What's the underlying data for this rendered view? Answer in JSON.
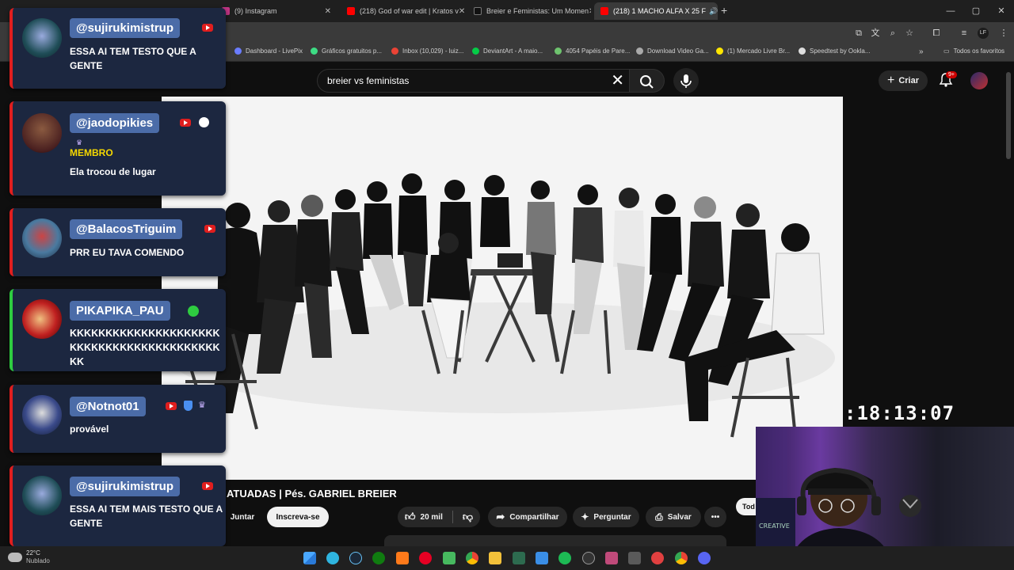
{
  "browser": {
    "tabs": [
      {
        "label": "(9) Instagram",
        "favicon_color": "#c13584",
        "active": false
      },
      {
        "label": "(218) God of war edit | Kratos v",
        "favicon_color": "#ff0000",
        "active": false
      },
      {
        "label": "Breier e Feministas: Um Momen",
        "favicon_color": "#111111",
        "active": false
      },
      {
        "label": "(218) 1 MACHO ALFA X 25 F",
        "favicon_color": "#ff0000",
        "active": true
      }
    ],
    "bookmarks": [
      {
        "label": "Dashboard - LivePix",
        "color": "#6a7cff"
      },
      {
        "label": "Gráficos gratuitos p...",
        "color": "#3ddc84"
      },
      {
        "label": "Inbox (10,029) - luiz...",
        "color": "#ea4335"
      },
      {
        "label": "DeviantArt - A maio...",
        "color": "#05cc47"
      },
      {
        "label": "4054 Papéis de Pare...",
        "color": "#6ec36e"
      },
      {
        "label": "Download Video Ga...",
        "color": "#aaaaaa"
      },
      {
        "label": "(1) Mercado Livre Br...",
        "color": "#ffe600"
      },
      {
        "label": "Speedtest by Ookla...",
        "color": "#dddddd"
      }
    ],
    "favorites_label": "Todos os favoritos"
  },
  "youtube": {
    "search_query": "breier vs feministas",
    "create_label": "Criar",
    "notification_count": "9+",
    "video_title": "ATUADAS | Pés. GABRIEL BREIER",
    "join_label": "Juntar",
    "subscribe_label": "Inscreva-se",
    "likes": "20 mil",
    "share_label": "Compartilhar",
    "ask_label": "Perguntar",
    "save_label": "Salvar",
    "chip_label": "Tod"
  },
  "chat": [
    {
      "username": "@sujirukimistrup",
      "message": "ESSA AI TEM TESTO QUE A GENTE",
      "avatar_color": "#1f4d57",
      "accent": "#e01e1e",
      "badge": ""
    },
    {
      "username": "@jaodopikies",
      "message": "Ela trocou de lugar",
      "avatar_color": "#6a3a30",
      "accent": "#e01e1e",
      "badge": "MEMBRO"
    },
    {
      "username": "@BalacosTriguim",
      "message": "PRR EU TAVA COMENDO",
      "avatar_color": "#4a7aa0",
      "accent": "#e01e1e",
      "badge": ""
    },
    {
      "username": "PIKAPIKA_PAU",
      "message": "KKKKKKKKKKKKKKKKKKKKKKKKKKKKKKKKKKKKKKKKKKKK",
      "avatar_color": "#c02020",
      "accent": "#2ecc40",
      "badge": ""
    },
    {
      "username": "@Notnot01",
      "message": "provável",
      "avatar_color": "#3a4a8a",
      "accent": "#e01e1e",
      "badge": ""
    },
    {
      "username": "@sujirukimistrup",
      "message": "ESSA AI TEM MAIS TESTO QUE A GENTE",
      "avatar_color": "#1f4d57",
      "accent": "#e01e1e",
      "badge": ""
    }
  ],
  "stream": {
    "timer": ":18:13:07"
  },
  "taskbar": {
    "temperature": "22°C",
    "weather": "Nublado"
  }
}
